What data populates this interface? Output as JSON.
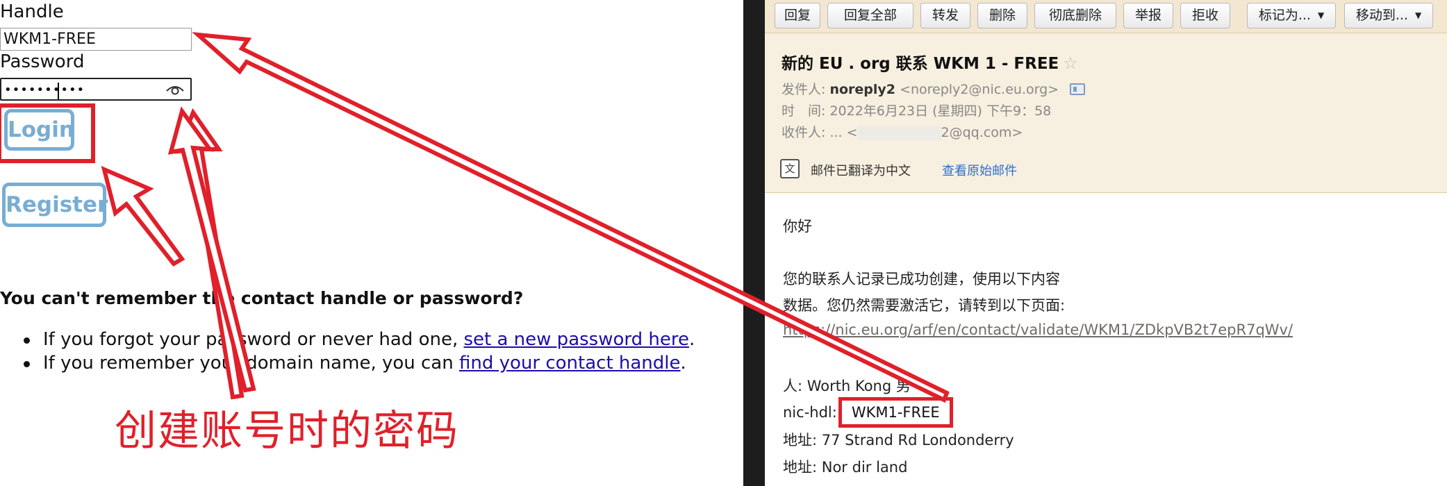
{
  "login_form": {
    "handle_label": "Handle",
    "handle_value": "WKM1-FREE",
    "password_label": "Password",
    "password_value": "••••••••••",
    "login_label": "Login",
    "register_label": "Register",
    "forgot_heading": "You can't remember the contact handle or password?",
    "help_items": [
      {
        "text": "If you forgot your password or never had one, ",
        "link": "set a new password here",
        "suffix": "."
      },
      {
        "text": "If you remember your domain name, you can ",
        "link": "find your contact handle",
        "suffix": "."
      }
    ],
    "annotation": "创建账号时的密码"
  },
  "toolbar": {
    "buttons": [
      "回复",
      "回复全部",
      "转发",
      "删除",
      "彻底删除",
      "举报",
      "拒收",
      "标记为...",
      "移动到..."
    ]
  },
  "mail": {
    "subject": "新的 EU . org 联系 WKM 1 - FREE",
    "sender_label": "发件人:",
    "sender_name": "noreply2",
    "sender_email": "<noreply2@nic.eu.org>",
    "time_label": "时　间:",
    "time_value": "2022年6月23日 (星期四) 下午9：58",
    "recipient_label": "收件人:",
    "recipient_prefix": "... <",
    "recipient_suffix": "2@qq.com>",
    "translate_notice": "邮件已翻译为中文",
    "view_original": "查看原始邮件",
    "greeting": "你好",
    "line1": "您的联系人记录已成功创建，使用以下内容",
    "line2": "数据。您仍然需要激活它，请转到以下页面:",
    "validate_url": "https://nic.eu.org/arf/en/contact/validate/WKM1/ZDkpVB2t7epR7qWv/",
    "name_line": "人: Worth Kong 男",
    "nic_hdl_label": "nic-hdl:",
    "nic_hdl_value": "WKM1-FREE",
    "address1": "地址: 77 Strand Rd Londonderry",
    "address2": "地址: Nor dir land"
  },
  "colors": {
    "annotation_red": "#e0202a",
    "button_blue": "#79add3",
    "toolbar_bg": "#f3e7d2",
    "header_bg": "#f7efdf",
    "link_blue": "#1a0dab"
  }
}
